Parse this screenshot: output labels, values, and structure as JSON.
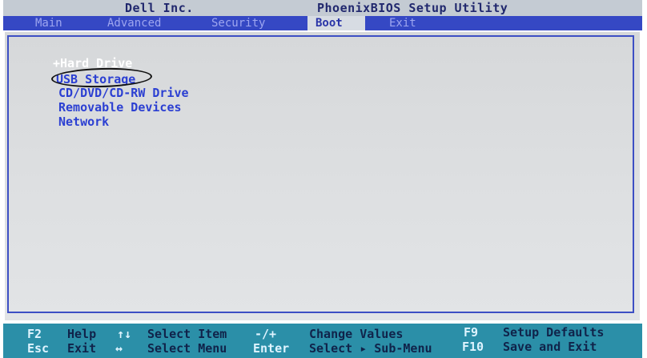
{
  "header": {
    "vendor": "Dell Inc.",
    "utility": "PhoenixBIOS Setup Utility"
  },
  "menu": {
    "items": [
      "Main",
      "Advanced",
      "Security",
      "Boot",
      "Exit"
    ],
    "active": "Boot"
  },
  "boot": {
    "items": [
      {
        "label": "+Hard Drive",
        "selected": true
      },
      {
        "label": "USB Storage",
        "selected": false
      },
      {
        "label": "CD/DVD/CD-RW Drive",
        "selected": false
      },
      {
        "label": "Removable Devices",
        "selected": false
      },
      {
        "label": "Network",
        "selected": false
      }
    ],
    "annotated": "USB Storage"
  },
  "footer": {
    "row1": [
      {
        "key": "F2",
        "desc": "Help"
      },
      {
        "key": "↑↓",
        "desc": "Select Item"
      },
      {
        "key": "-/+",
        "desc": "Change Values"
      },
      {
        "key": "F9",
        "desc": "Setup Defaults"
      }
    ],
    "row2": [
      {
        "key": "Esc",
        "desc": "Exit"
      },
      {
        "key": "↔",
        "desc": "Select Menu"
      },
      {
        "key": "Enter",
        "desc": "Select ▸ Sub-Menu"
      },
      {
        "key": "F10",
        "desc": "Save and Exit"
      }
    ]
  },
  "colors": {
    "menubar": "#3548c4",
    "active_tab_bg": "#d7dce3",
    "boot_item": "#2b3fd2",
    "footer": "#2b8fa8"
  }
}
